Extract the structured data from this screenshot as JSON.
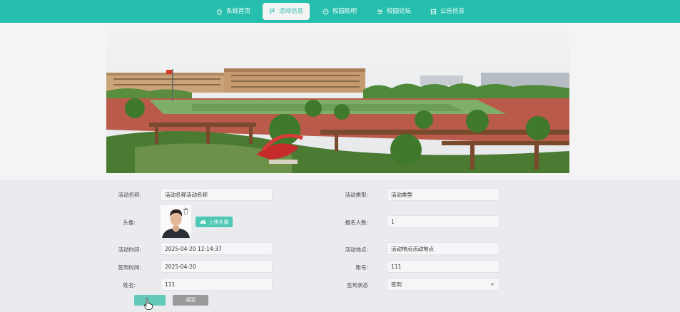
{
  "nav": {
    "items": [
      {
        "label": "系统首页",
        "icon": "home-icon",
        "active": false
      },
      {
        "label": "活动信息",
        "icon": "flag-icon",
        "active": true
      },
      {
        "label": "校园贴吧",
        "icon": "forum-icon",
        "active": false
      },
      {
        "label": "校园论坛",
        "icon": "sliders-icon",
        "active": false
      },
      {
        "label": "公告信息",
        "icon": "notice-icon",
        "active": false
      }
    ]
  },
  "carousel": {
    "slide_count": 3,
    "active_index": 0
  },
  "form": {
    "activity_name": {
      "label": "活动名称:",
      "value": "活动名称活动名称"
    },
    "activity_type": {
      "label": "活动类型:",
      "value": "活动类型"
    },
    "avatar": {
      "label": "头像:",
      "upload_label": "上传头像"
    },
    "enroll_count": {
      "label": "报名人数:",
      "value": "1"
    },
    "activity_time": {
      "label": "活动时间:",
      "value": "2025-04-20 12:14:37"
    },
    "activity_place": {
      "label": "活动地点:",
      "value": "活动地点活动地点"
    },
    "signin_time": {
      "label": "签到时间:",
      "value": "2025-04-20"
    },
    "account": {
      "label": "账号:",
      "value": "111"
    },
    "name": {
      "label": "姓名:",
      "value": "111"
    },
    "signin_status": {
      "label": "签到状态",
      "value": "签到"
    }
  },
  "buttons": {
    "submit": "",
    "back": "返回"
  },
  "colors": {
    "primary": "#26bfae",
    "form_bg": "#e9ebee"
  }
}
